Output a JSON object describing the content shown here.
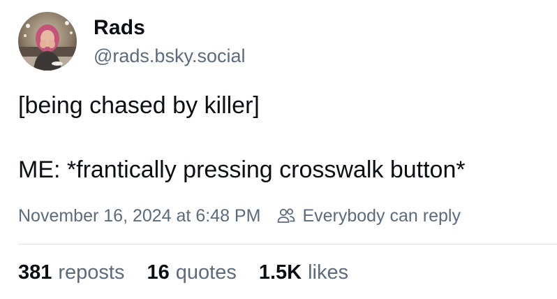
{
  "author": {
    "display_name": "Rads",
    "handle": "@rads.bsky.social"
  },
  "post": {
    "lines": [
      "[being chased by killer]",
      "ME: *frantically pressing crosswalk button*"
    ],
    "timestamp": "November 16, 2024 at 6:48 PM",
    "reply_permission": "Everybody can reply",
    "reply_permission_icon": "people-icon"
  },
  "stats": {
    "reposts": {
      "count": "381",
      "label": "reposts"
    },
    "quotes": {
      "count": "16",
      "label": "quotes"
    },
    "likes": {
      "count": "1.5K",
      "label": "likes"
    }
  },
  "colors": {
    "text_primary": "#0b0f14",
    "text_secondary": "#5b6b7c",
    "divider": "#dfe3e8"
  }
}
